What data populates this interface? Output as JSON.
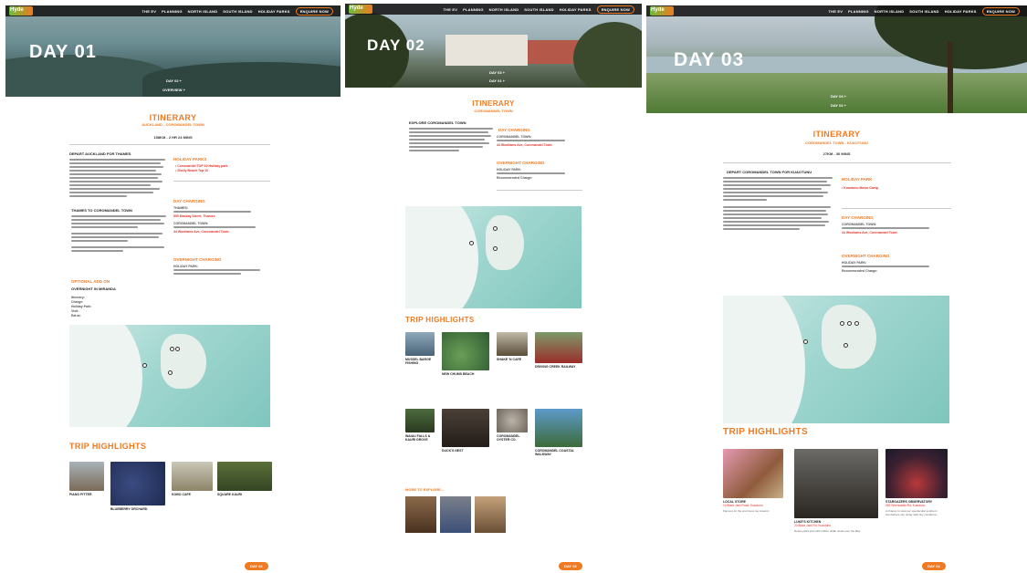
{
  "nav": {
    "logo": "Hyde",
    "items": [
      "THE EV",
      "PLANNING",
      "NORTH ISLAND",
      "SOUTH ISLAND",
      "HOLIDAY PARKS"
    ],
    "enquire": "ENQUIRE NOW"
  },
  "panel1": {
    "day": "DAY 01",
    "hero_links": [
      "DAY 02 +",
      "OVERVIEW +"
    ],
    "title": "ITINERARY",
    "route": "AUCKLAND - COROMANDEL TOWN",
    "time": "158KM - 2 HR 24 MINS",
    "depart_h": "DEPART AUCKLAND FOR THAMES",
    "holiday_parks_h": "HOLIDAY PARKS",
    "hp1": "Coromandel TOP 10 Holiday park",
    "hp2": "Shelly Beach Top 10",
    "day_charging_h": "DAY CHARGING",
    "thames_charge": "THAMES:",
    "thames_addr": "505 Mackay Street, Thames",
    "coro_charge": "COROMANDEL TOWN:",
    "coro_addr": "44 Woollams Ave, Coromandel Town",
    "overnight_h": "OVERNIGHT CHARGING",
    "overnight_txt": "HOLIDAY PARK:",
    "thames_to": "THAMES TO COROMANDEL TOWN",
    "optional_h": "OPTIONAL ADD ON",
    "overnight_miranda": "OVERNIGHT IN MIRANDA",
    "miranda_lines": [
      "Itinerary:",
      "Charge:",
      "Holiday Park:",
      "Visit:",
      "Eat at:"
    ],
    "trip_h": "TRIP HIGHLIGHTS",
    "cards": [
      {
        "t": "PIANO PITTER"
      },
      {
        "t": "BLUEBERRY ORCHARD"
      },
      {
        "t": "KOBO CAFE"
      },
      {
        "t": "SQUARE KAURI"
      }
    ],
    "day_btn": "DAY 02"
  },
  "panel2": {
    "day": "DAY 02",
    "hero_links": [
      "DAY 03 +",
      "DAY 01 +"
    ],
    "title": "ITINERARY",
    "route": "COROMANDEL TOWN",
    "explore_h": "EXPLORE COROMANDEL TOWN",
    "day_charging_h": "DAY CHARGING",
    "coro_charge": "COROMANDEL TOWN:",
    "coro_addr": "44 Woollams Ave, Coromandel Town",
    "overnight_h": "OVERNIGHT CHARGING",
    "overnight_txt": "HOLIDAY PARK:",
    "rec_charge": "Recommended Charge:",
    "trip_h": "TRIP HIGHLIGHTS",
    "cards": [
      {
        "t": "MUSSEL BARGE FISHING"
      },
      {
        "t": "NEW CHUMS BEACH"
      },
      {
        "t": "SHAKE 'N CAFE"
      },
      {
        "t": "DRIVING CREEK RAILWAY"
      },
      {
        "t": "WAIAU FALLS & KAURI GROVE"
      },
      {
        "t": "DUCK'S NEST"
      },
      {
        "t": "COROMANDEL OYSTER CO."
      },
      {
        "t": "COROMANDEL COASTAL WALKWAY"
      }
    ],
    "more_h": "MORE TO EXPLORE...",
    "day_btn": "DAY 03"
  },
  "panel3": {
    "day": "DAY 03",
    "hero_links": [
      "DAY 04 +",
      "DAY 02 +"
    ],
    "title": "ITINERARY",
    "route": "COROMANDEL TOWN - KUAOTUNU",
    "time": "27KM - 30 MINS",
    "depart_h": "DEPART COROMANDEL TOWN FOR KUAOTUNU",
    "holiday_park_h": "HOLIDAY PARK",
    "hp1": "Kuaotunu Motor Camp",
    "day_charging_h": "DAY CHARGING",
    "coro_charge": "COROMANDEL TOWN:",
    "coro_addr": "44 Woollams Ave, Coromandel Town",
    "overnight_h": "OVERNIGHT CHARGING",
    "overnight_txt": "HOLIDAY PARK:",
    "rec_charge": "Recommended Charge:",
    "trip_h": "TRIP HIGHLIGHTS",
    "cards": [
      {
        "t": "LOCAL STORE",
        "l": "14 Black Jack Road, Kuaotunu",
        "d": "Famous for the enormous ice creams!"
      },
      {
        "t": "LUKE'S KITCHEN",
        "l": "20 Black Jack Rd, Kuaotunu",
        "d": "Rustic pizza joint with million dollar views over the Bay."
      },
      {
        "t": "STARGAZERS OBSERVATORY",
        "l": "352 Whenuakite Rd, Kuaotunu",
        "d": "A chance to view our spectacular southern hemisphere sky under dark sky conditions."
      }
    ],
    "day_btn": "DAY 04"
  }
}
